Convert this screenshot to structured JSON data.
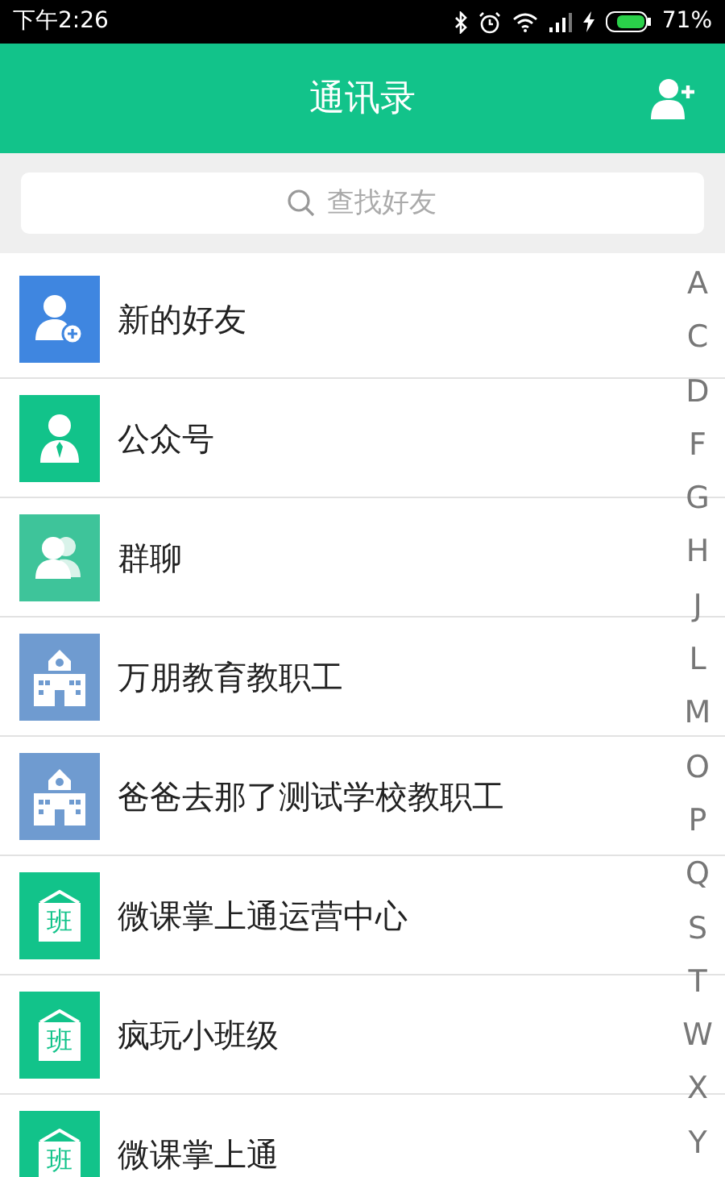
{
  "status_bar": {
    "time": "下午2:26",
    "battery_text": "71%"
  },
  "header": {
    "title": "通讯录"
  },
  "search": {
    "placeholder": "查找好友"
  },
  "contacts": [
    {
      "kind": "new_friend",
      "name": "新的好友"
    },
    {
      "kind": "official",
      "name": "公众号"
    },
    {
      "kind": "group",
      "name": "群聊"
    },
    {
      "kind": "school",
      "name": "万朋教育教职工"
    },
    {
      "kind": "school",
      "name": "爸爸去那了测试学校教职工"
    },
    {
      "kind": "class",
      "name": "微课掌上通运营中心",
      "icon_text": "班"
    },
    {
      "kind": "class",
      "name": "疯玩小班级",
      "icon_text": "班"
    },
    {
      "kind": "class",
      "name": "微课掌上通",
      "icon_text": "班"
    }
  ],
  "index_letters": [
    "A",
    "C",
    "D",
    "F",
    "G",
    "H",
    "J",
    "L",
    "M",
    "O",
    "P",
    "Q",
    "S",
    "T",
    "W",
    "X",
    "Y"
  ]
}
